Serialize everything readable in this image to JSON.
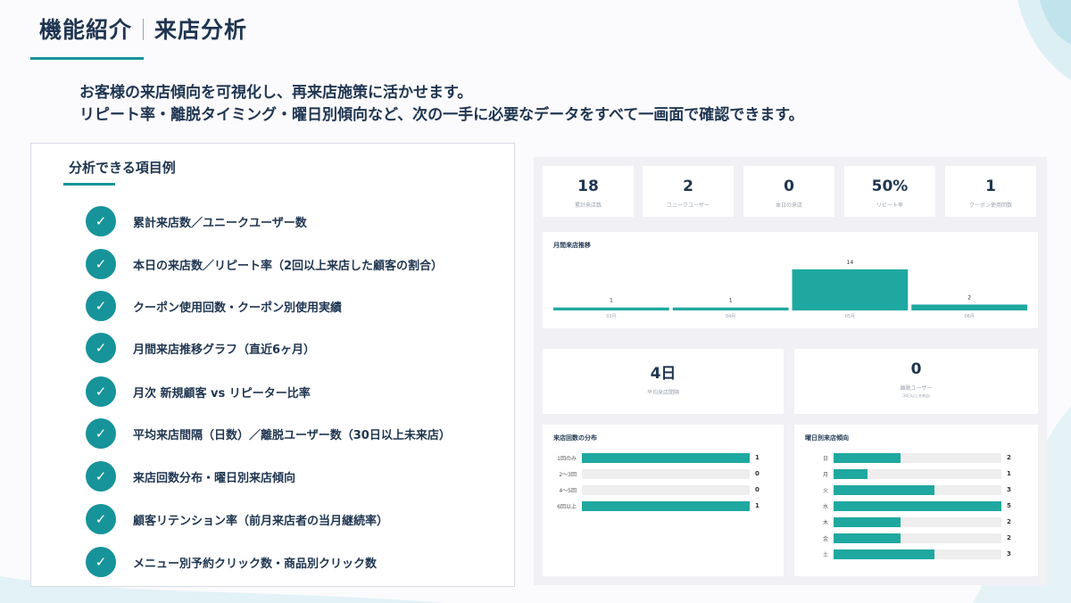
{
  "header": {
    "title_part1": "機能紹介",
    "title_part2": "来店分析"
  },
  "intro": {
    "line1": "お客様の来店傾向を可視化し、再来店施策に活かせます。",
    "line2": "リピート率・離脱タイミング・曜日別傾向など、次の一手に必要なデータをすべて一画面で確認できます。"
  },
  "items_panel": {
    "title": "分析できる項目例",
    "items": [
      "累計来店数／ユニークユーザー数",
      "本日の来店数／リピート率（2回以上来店した顧客の割合）",
      "クーポン使用回数・クーポン別使用実績",
      "月間来店推移グラフ（直近6ヶ月）",
      "月次 新規顧客 vs リピーター比率",
      "平均来店間隔（日数）／離脱ユーザー数（30日以上未来店）",
      "来店回数分布・曜日別来店傾向",
      "顧客リテンション率（前月来店者の当月継続率）",
      "メニュー別予約クリック数・商品別クリック数"
    ],
    "check_icon": "check-circle-icon"
  },
  "dashboard": {
    "kpis": [
      {
        "value": "18",
        "label": "累計来店数"
      },
      {
        "value": "2",
        "label": "ユニークユーザー"
      },
      {
        "value": "0",
        "label": "本日の来店"
      },
      {
        "value": "50%",
        "label": "リピート率"
      },
      {
        "value": "1",
        "label": "クーポン使用回数"
      }
    ],
    "monthly": {
      "title": "月間来店推移"
    },
    "avg_interval": {
      "value": "4日",
      "label": "平均来店間隔"
    },
    "churn": {
      "value": "0",
      "label": "離脱ユーザー",
      "sublabel": "（30日以上未来店）"
    },
    "visit_dist": {
      "title": "来店回数の分布"
    },
    "weekday": {
      "title": "曜日別来店傾向"
    }
  },
  "colors": {
    "accent": "#17939a",
    "bar": "#1fa8a0",
    "text": "#1f3550"
  },
  "chart_data": [
    {
      "type": "bar",
      "title": "月間来店推移",
      "categories": [
        "03月",
        "04月",
        "05月",
        "06月"
      ],
      "values": [
        1,
        1,
        14,
        2
      ],
      "ylim": [
        0,
        14
      ]
    },
    {
      "type": "bar",
      "orientation": "horizontal",
      "title": "来店回数の分布",
      "categories": [
        "1回のみ",
        "2〜3回",
        "4〜5回",
        "6回以上"
      ],
      "values": [
        1,
        0,
        0,
        1
      ],
      "xlim": [
        0,
        1
      ]
    },
    {
      "type": "bar",
      "orientation": "horizontal",
      "title": "曜日別来店傾向",
      "categories": [
        "日",
        "月",
        "火",
        "水",
        "木",
        "金",
        "土"
      ],
      "values": [
        2,
        1,
        3,
        5,
        2,
        2,
        3
      ],
      "xlim": [
        0,
        5
      ]
    }
  ]
}
